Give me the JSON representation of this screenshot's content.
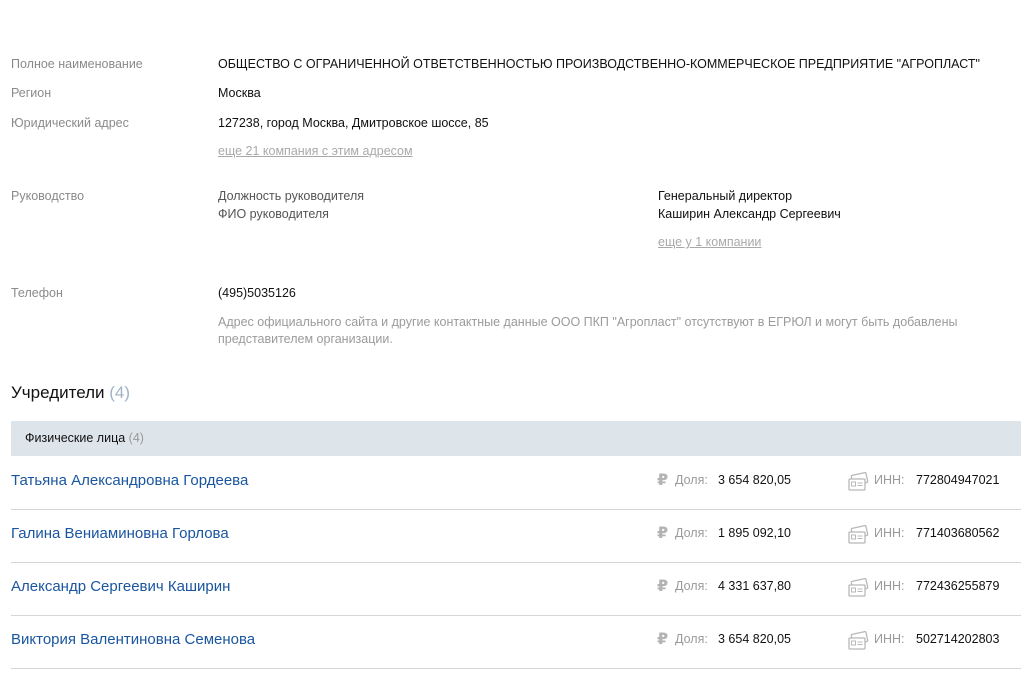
{
  "info": {
    "full_name_label": "Полное наименование",
    "full_name_value": "ОБЩЕСТВО С ОГРАНИЧЕННОЙ ОТВЕТСТВЕННОСТЬЮ ПРОИЗВОДСТВЕННО-КОММЕРЧЕСКОЕ ПРЕДПРИЯТИЕ \"АГРОПЛАСТ\"",
    "region_label": "Регион",
    "region_value": "Москва",
    "address_label": "Юридический адрес",
    "address_value": "127238, город Москва, Дмитровское шоссе, 85",
    "address_link": "еще 21 компания с этим адресом",
    "management_label": "Руководство",
    "position_label": "Должность руководителя",
    "fio_label": "ФИО руководителя",
    "position_value": "Генеральный директор",
    "fio_value": "Каширин Александр Сергеевич",
    "manager_link": "еще у 1 компании",
    "phone_label": "Телефон",
    "phone_value": "(495)5035126",
    "contacts_note": "Адрес официального сайта и другие контактные данные ООО ПКП \"Агропласт\" отсутствуют в ЕГРЮЛ и могут быть добавлены представителем организации."
  },
  "founders": {
    "title": "Учредители",
    "count": "(4)",
    "individuals_label": "Физические лица",
    "individuals_count": "(4)",
    "share_label": "Доля:",
    "inn_label": "ИНН:",
    "currency_icon": "ruble-icon",
    "inn_icon": "id-card-icon",
    "rows": [
      {
        "name": "Татьяна Александровна Гордеева",
        "share": "3 654 820,05",
        "inn": "772804947021"
      },
      {
        "name": "Галина Вениаминовна Горлова",
        "share": "1 895 092,10",
        "inn": "771403680562"
      },
      {
        "name": "Александр Сергеевич Каширин",
        "share": "4 331 637,80",
        "inn": "772436255879"
      },
      {
        "name": "Виктория Валентиновна Семенова",
        "share": "3 654 820,05",
        "inn": "502714202803"
      }
    ]
  },
  "colors": {
    "link": "#1a56a0",
    "label": "#8a8a8a",
    "subheader_bg": "#dde4ea",
    "count": "#9fb3c8"
  }
}
